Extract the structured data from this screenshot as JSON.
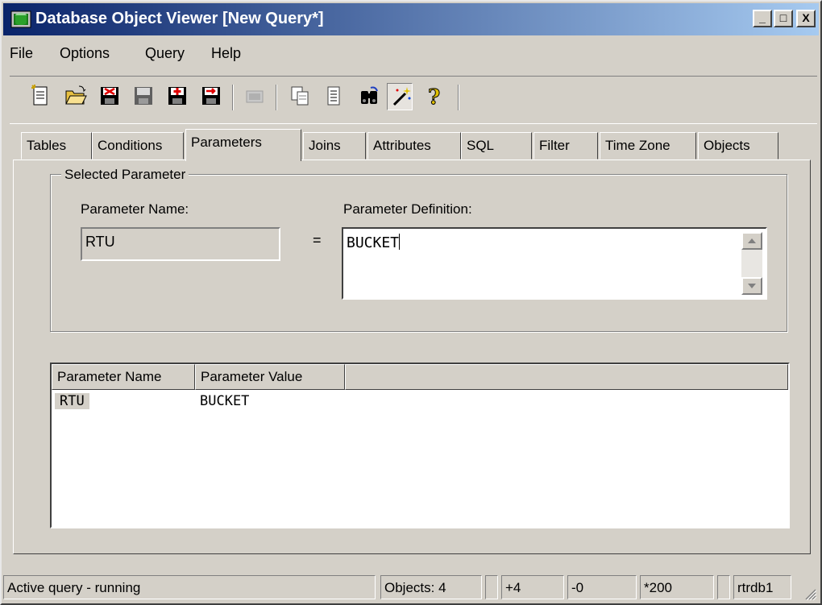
{
  "window": {
    "title": "Database Object Viewer [New Query*]",
    "controls": {
      "minimize": "_",
      "maximize": "□",
      "close": "X"
    }
  },
  "menu": [
    "File",
    "Options",
    "Query",
    "Help"
  ],
  "toolbar": {
    "buttons": [
      "new-query-icon",
      "open-icon",
      "delete-icon",
      "save-icon",
      "save-add-icon",
      "save-as-icon",
      "disabled-icon",
      "copy-icon",
      "list-icon",
      "find-icon",
      "wizard-icon",
      "help-icon"
    ]
  },
  "tabs": [
    "Tables",
    "Conditions",
    "Parameters",
    "Joins",
    "Attributes",
    "SQL",
    "Filter",
    "Time Zone",
    "Objects"
  ],
  "active_tab": "Parameters",
  "selected_parameter": {
    "group_title": "Selected Parameter",
    "name_label": "Parameter Name:",
    "name_value": "RTU",
    "equals": "=",
    "definition_label": "Parameter Definition:",
    "definition_value": "BUCKET"
  },
  "parameter_list": {
    "columns": [
      "Parameter Name",
      "Parameter Value"
    ],
    "rows": [
      {
        "name": "RTU",
        "value": "BUCKET"
      }
    ]
  },
  "status": {
    "message": "Active query - running",
    "objects": "Objects: 4",
    "plus": "+4",
    "minus": "-0",
    "limit": "*200",
    "database": "rtrdb1"
  },
  "colors": {
    "face": "#d4d0c8",
    "title_start": "#0a246a",
    "title_end": "#a6caf0"
  }
}
